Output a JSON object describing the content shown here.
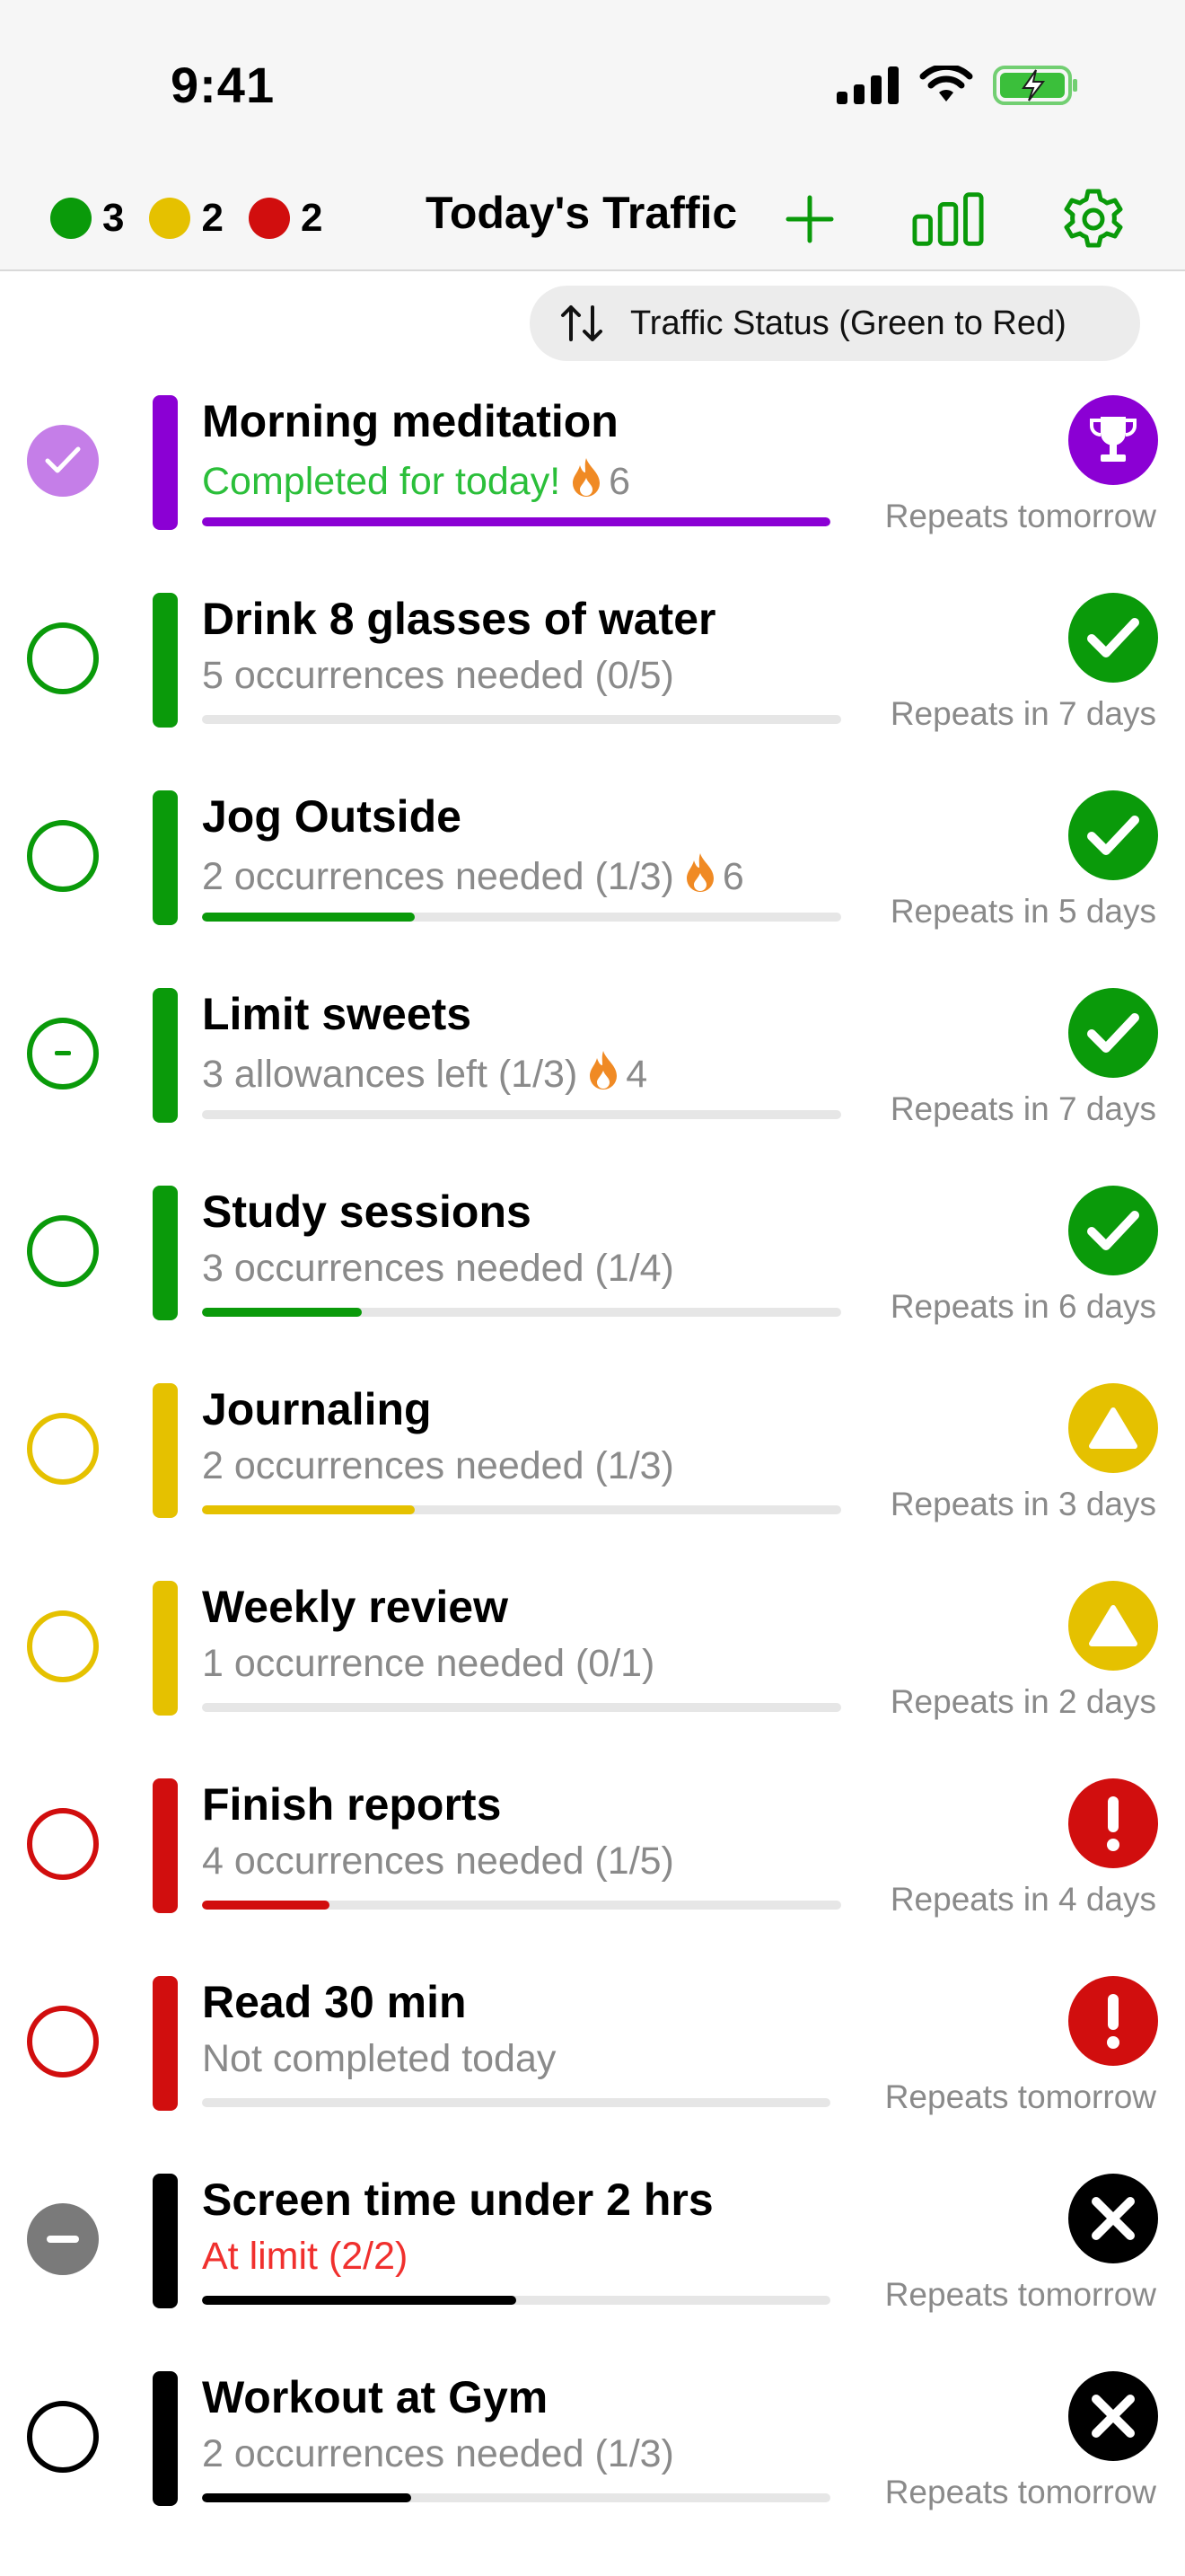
{
  "status_bar": {
    "time": "9:41"
  },
  "nav": {
    "counts": [
      {
        "color": "#0a9a0a",
        "value": "3",
        "name": "green"
      },
      {
        "color": "#e5c100",
        "value": "2",
        "name": "yellow"
      },
      {
        "color": "#d10e0e",
        "value": "2",
        "name": "red"
      }
    ],
    "title": "Today's Traffic",
    "accent": "#0a9a0a"
  },
  "sort": {
    "label": "Traffic Status (Green to Red)"
  },
  "rows": [
    {
      "title": "Morning meditation",
      "subtitle": "Completed for today!",
      "subtitle_color": "#2bbf3a",
      "streak": "6",
      "progress": 1.0,
      "color": "#8b00d4",
      "status": "trophy",
      "status_color": "#8b00d4",
      "check": "done",
      "repeat": "Repeats tomorrow"
    },
    {
      "title": "Drink 8 glasses of water",
      "subtitle": "5 occurrences needed (0/5)",
      "subtitle_color": "#8a8a8a",
      "streak": "",
      "progress": 0.0,
      "color": "#0a9a0a",
      "status": "check",
      "status_color": "#0a9a0a",
      "check": "empty",
      "repeat": "Repeats in 7 days"
    },
    {
      "title": "Jog Outside",
      "subtitle": "2 occurrences needed (1/3)",
      "subtitle_color": "#8a8a8a",
      "streak": "6",
      "progress": 0.333,
      "color": "#0a9a0a",
      "status": "check",
      "status_color": "#0a9a0a",
      "check": "empty",
      "repeat": "Repeats in 5 days"
    },
    {
      "title": "Limit sweets",
      "subtitle": "3 allowances left (1/3)",
      "subtitle_color": "#8a8a8a",
      "streak": "4",
      "progress": 0.0,
      "color": "#0a9a0a",
      "status": "check",
      "status_color": "#0a9a0a",
      "check": "minus",
      "repeat": "Repeats in 7 days"
    },
    {
      "title": "Study sessions",
      "subtitle": "3 occurrences needed (1/4)",
      "subtitle_color": "#8a8a8a",
      "streak": "",
      "progress": 0.25,
      "color": "#0a9a0a",
      "status": "check",
      "status_color": "#0a9a0a",
      "check": "empty",
      "repeat": "Repeats in 6 days"
    },
    {
      "title": "Journaling",
      "subtitle": "2 occurrences needed (1/3)",
      "subtitle_color": "#8a8a8a",
      "streak": "",
      "progress": 0.333,
      "color": "#e5c100",
      "status": "triangle",
      "status_color": "#e5c100",
      "check": "empty",
      "repeat": "Repeats in 3 days"
    },
    {
      "title": "Weekly review",
      "subtitle": "1 occurrence needed (0/1)",
      "subtitle_color": "#8a8a8a",
      "streak": "",
      "progress": 0.0,
      "color": "#e5c100",
      "status": "triangle",
      "status_color": "#e5c100",
      "check": "empty",
      "repeat": "Repeats in 2 days"
    },
    {
      "title": "Finish reports",
      "subtitle": "4 occurrences needed (1/5)",
      "subtitle_color": "#8a8a8a",
      "streak": "",
      "progress": 0.2,
      "color": "#d10e0e",
      "status": "exclaim",
      "status_color": "#d10e0e",
      "check": "empty",
      "repeat": "Repeats in 4 days"
    },
    {
      "title": "Read 30 min",
      "subtitle": "Not completed today",
      "subtitle_color": "#8a8a8a",
      "streak": "",
      "progress": 0.0,
      "color": "#d10e0e",
      "status": "exclaim",
      "status_color": "#d10e0e",
      "check": "empty",
      "repeat": "Repeats tomorrow"
    },
    {
      "title": "Screen time under 2 hrs",
      "subtitle": "At limit (2/2)",
      "subtitle_color": "#f0302e",
      "streak": "",
      "progress": 0.5,
      "color": "#000000",
      "status": "x",
      "status_color": "#000000",
      "check": "limit",
      "repeat": "Repeats tomorrow"
    },
    {
      "title": "Workout at Gym",
      "subtitle": "2 occurrences needed (1/3)",
      "subtitle_color": "#8a8a8a",
      "streak": "",
      "progress": 0.333,
      "color": "#000000",
      "status": "x",
      "status_color": "#000000",
      "check": "empty",
      "repeat": "Repeats tomorrow"
    }
  ]
}
